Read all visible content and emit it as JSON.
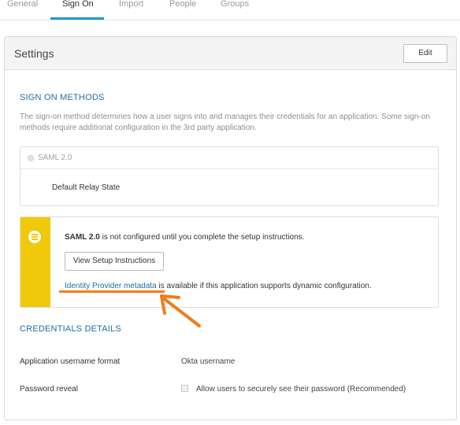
{
  "tabs": [
    {
      "label": "General",
      "active": false
    },
    {
      "label": "Sign On",
      "active": true
    },
    {
      "label": "Import",
      "active": false
    },
    {
      "label": "People",
      "active": false
    },
    {
      "label": "Groups",
      "active": false
    }
  ],
  "settings": {
    "title": "Settings",
    "edit_label": "Edit"
  },
  "sign_on_methods": {
    "title": "SIGN ON METHODS",
    "description": "The sign-on method determines how a user signs into and manages their credentials for an application. Some sign-on methods require additional configuration in the 3rd party application.",
    "saml_label": "SAML 2.0",
    "relay_state_label": "Default Relay State"
  },
  "notice": {
    "bold_text": "SAML 2.0",
    "text": " is not configured until you complete the setup instructions.",
    "setup_button": "View Setup Instructions",
    "metadata_link": "Identity Provider metadata",
    "metadata_text": " is available if this application supports dynamic configuration.",
    "stripe_color": "#f0c90a",
    "icon": "list-icon"
  },
  "annotation": {
    "color": "#ef7d1a",
    "icon": "arrow-icon"
  },
  "credentials": {
    "title": "CREDENTIALS DETAILS",
    "username_format_label": "Application username format",
    "username_format_value": "Okta username",
    "password_reveal_label": "Password reveal",
    "password_reveal_option": "Allow users to securely see their password (Recommended)",
    "password_reveal_checked": false
  },
  "colors": {
    "accent": "#1d9bd1",
    "section_title": "#1f6ea5"
  }
}
